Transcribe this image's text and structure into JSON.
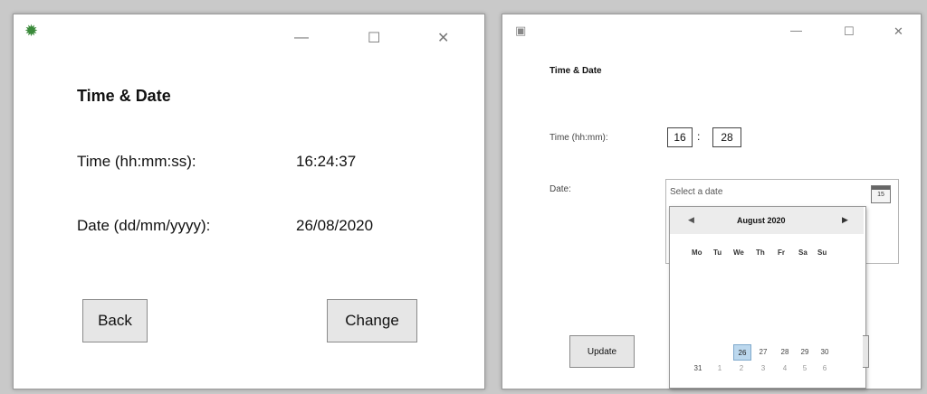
{
  "left_window": {
    "app_icon": "gear-icon",
    "title": "Time & Date",
    "time_label": "Time (hh:mm:ss):",
    "time_value": "16:24:37",
    "date_label": "Date (dd/mm/yyyy):",
    "date_value": "26/08/2020",
    "back_label": "Back",
    "change_label": "Change",
    "controls": {
      "minimize": "—",
      "maximize": "☐",
      "close": "✕"
    }
  },
  "right_window": {
    "title": "Time & Date",
    "time_label": "Time (hh:mm):",
    "hour": "16",
    "minute": "28",
    "separator": ":",
    "date_label": "Date:",
    "date_placeholder": "Select a date",
    "update_label": "Update",
    "controls": {
      "minimize": "—",
      "maximize": "☐",
      "close": "✕"
    },
    "calendar": {
      "month_label": "August 2020",
      "prev": "◀",
      "next": "▶",
      "weekdays": [
        "Mo",
        "Tu",
        "We",
        "Th",
        "Fr",
        "Sa",
        "Su"
      ],
      "row1": [
        "26",
        "27",
        "28",
        "29",
        "30"
      ],
      "row2": [
        "31",
        "1",
        "2",
        "3",
        "4",
        "5",
        "6"
      ],
      "selected_day": "26"
    }
  }
}
